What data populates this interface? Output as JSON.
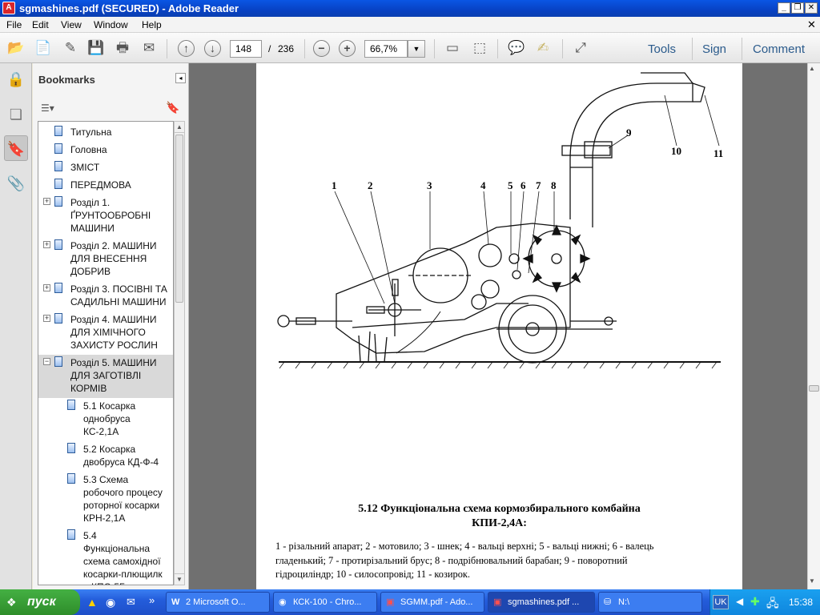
{
  "window": {
    "title": "sgmashines.pdf (SECURED) - Adobe Reader",
    "icon": "pdf-icon"
  },
  "menu": [
    "File",
    "Edit",
    "View",
    "Window",
    "Help"
  ],
  "toolbar": {
    "page_current": "148",
    "page_separator": "/",
    "page_total": "236",
    "zoom": "66,7%",
    "links": [
      "Tools",
      "Sign",
      "Comment"
    ]
  },
  "bookmarks": {
    "title": "Bookmarks",
    "items": [
      {
        "label_lines": [
          "Титульна"
        ]
      },
      {
        "label_lines": [
          "Головна"
        ]
      },
      {
        "label_lines": [
          "ЗМІСТ"
        ]
      },
      {
        "label_lines": [
          "ПЕРЕДМОВА"
        ]
      },
      {
        "label_lines": [
          "Розділ 1.",
          "ҐРУНТООБРОБНІ",
          "МАШИНИ"
        ],
        "expander": "+"
      },
      {
        "label_lines": [
          "Розділ 2. МАШИНИ",
          "ДЛЯ ВНЕСЕННЯ",
          "ДОБРИВ"
        ],
        "expander": "+"
      },
      {
        "label_lines": [
          "Розділ 3. ПОСІВНІ ТА",
          "САДИЛЬНІ МАШИНИ"
        ],
        "expander": "+"
      },
      {
        "label_lines": [
          "Розділ 4. МАШИНИ",
          "ДЛЯ ХІМІЧНОГО",
          "ЗАХИСТУ РОСЛИН"
        ],
        "expander": "+"
      },
      {
        "label_lines": [
          "Розділ 5. МАШИНИ",
          "ДЛЯ ЗАГОТІВЛІ",
          "КОРМІВ"
        ],
        "expander": "−",
        "selected": true
      },
      {
        "label_lines": [
          "5.1 Косарка",
          "однобруса",
          "КС-2,1А"
        ],
        "child": true
      },
      {
        "label_lines": [
          "5.2 Косарка",
          "двобруса КД-Ф-4"
        ],
        "child": true
      },
      {
        "label_lines": [
          "5.3 Схема",
          "робочого процесу",
          "роторної косарки",
          "КРН-2,1А"
        ],
        "child": true
      },
      {
        "label_lines": [
          "5.4",
          "Функціональна",
          "схема самохідної",
          "косарки-плющилк",
          "и КПС-5Г"
        ],
        "child": true
      }
    ]
  },
  "document": {
    "numbers": [
      "1",
      "2",
      "3",
      "4",
      "5",
      "6",
      "7",
      "8",
      "9",
      "10",
      "11"
    ],
    "caption_line1": "5.12 Функціональна схема кормозбирального комбайна",
    "caption_line2": "КПИ-2,4А:",
    "legend_line1": "1 - різальний апарат; 2 - мотовило; 3 - шнек; 4 - вальці верхні; 5 - вальці нижні; 6 - валець",
    "legend_line2": "гладенький; 7 - протирізальний брус; 8 - подрібнювальний барабан; 9 - поворотний",
    "legend_line3": "гідроциліндр; 10 - силосопровід; 11 - козирок."
  },
  "taskbar": {
    "start": "пуск",
    "tasks": [
      "2 Microsoft O...",
      "КСК-100 - Chro...",
      "SGMM.pdf - Ado...",
      "sgmashines.pdf ...",
      "N:\\"
    ],
    "language": "UK",
    "clock": "15:38"
  }
}
